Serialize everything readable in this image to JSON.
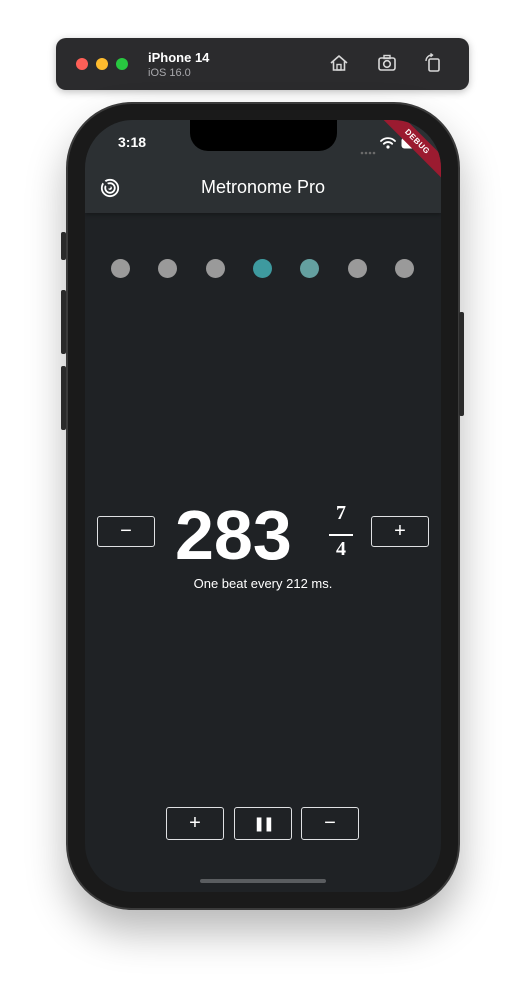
{
  "simulator": {
    "device_name": "iPhone 14",
    "os_version": "iOS 16.0",
    "toolbar_icons": [
      "home-icon",
      "screenshot-icon",
      "rotate-icon"
    ]
  },
  "status_bar": {
    "time": "3:18",
    "icons": [
      "signal-icon",
      "wifi-icon",
      "battery-icon"
    ]
  },
  "debug_banner": "DEBUG",
  "app_bar": {
    "title": "Metronome Pro",
    "logo_icon": "radar-icon"
  },
  "beats": {
    "total": 7,
    "states": [
      "inactive",
      "inactive",
      "inactive",
      "active",
      "accent",
      "inactive",
      "inactive"
    ],
    "colors": {
      "inactive": "#9a9a9a",
      "active": "#3e9a9f",
      "accent": "#64a0a0"
    }
  },
  "tempo": {
    "bpm": "283",
    "decrease_label": "−",
    "increase_label": "+",
    "time_signature": {
      "numerator": "7",
      "denominator": "4"
    },
    "interval_text": "One beat every 212 ms."
  },
  "controls": {
    "add_label": "+",
    "pause_label": "❚❚",
    "remove_label": "−"
  }
}
